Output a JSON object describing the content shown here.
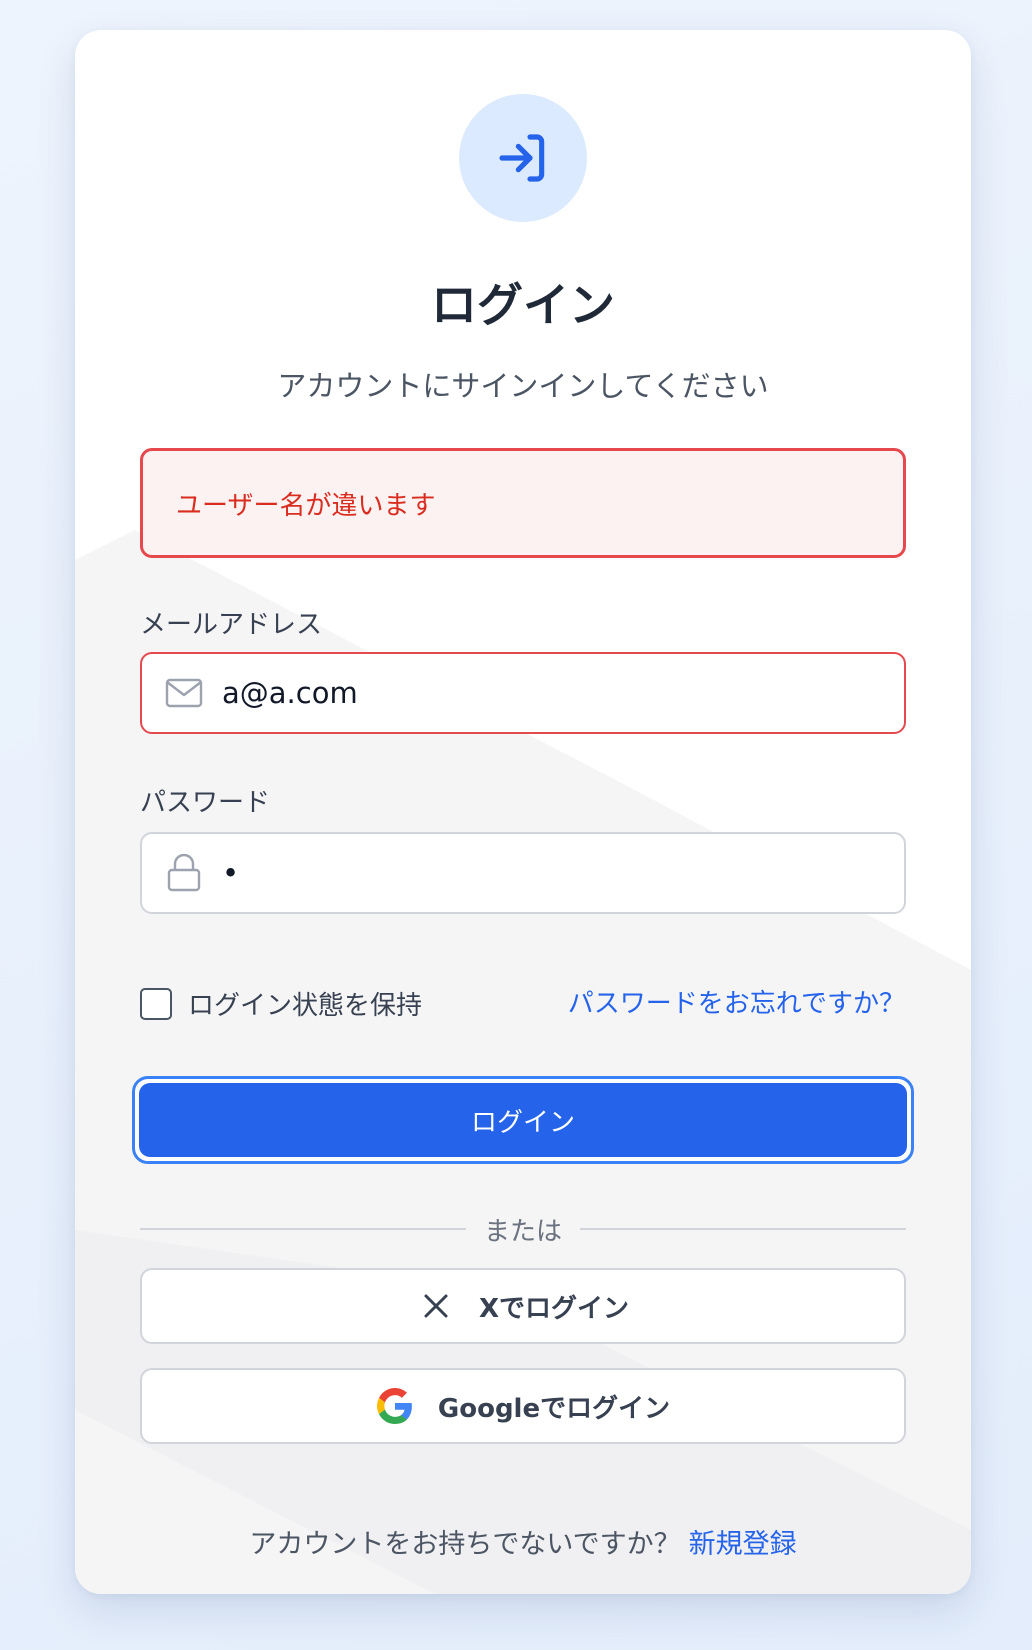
{
  "header": {
    "icon": "login-arrow-icon",
    "title": "ログイン",
    "subtitle": "アカウントにサインインしてください"
  },
  "error": {
    "message": "ユーザー名が違います"
  },
  "email": {
    "label": "メールアドレス",
    "icon": "mail-icon",
    "value": "a@a.com"
  },
  "password": {
    "label": "パスワード",
    "icon": "lock-icon",
    "value": "•"
  },
  "remember": {
    "label": "ログイン状態を保持",
    "checked": false
  },
  "forgot_link": "パスワードをお忘れですか？",
  "login_button": "ログイン",
  "divider_text": "または",
  "social": {
    "x_label": "Xでログイン",
    "x_icon": "x-close-icon",
    "google_label": "Googleでログイン",
    "google_icon": "google-logo-icon"
  },
  "signup": {
    "prompt": "アカウントをお持ちでないですか？",
    "link": "新規登録"
  },
  "colors": {
    "accent": "#2563eb",
    "error": "#e5484d",
    "error_bg": "#fdf2f2"
  }
}
